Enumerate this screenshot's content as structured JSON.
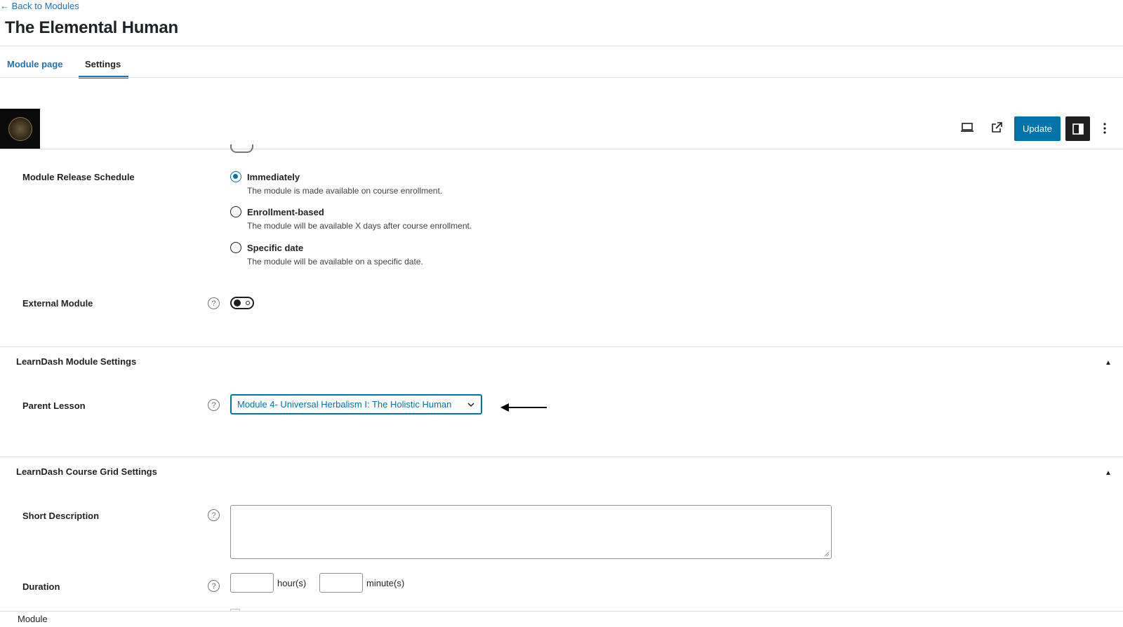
{
  "header": {
    "back_link": "← Back to Modules",
    "title": "The Elemental Human"
  },
  "tabs": [
    {
      "label": "Module page",
      "active": false
    },
    {
      "label": "Settings",
      "active": true
    }
  ],
  "toolbar": {
    "update_label": "Update",
    "icons": [
      "laptop-preview-icon",
      "external-link-icon",
      "sidebar-toggle-icon",
      "more-options-icon"
    ]
  },
  "release_schedule": {
    "label": "Module Release Schedule",
    "options": [
      {
        "label": "Immediately",
        "description": "The module is made available on course enrollment.",
        "selected": true
      },
      {
        "label": "Enrollment-based",
        "description": "The module will be available X days after course enrollment.",
        "selected": false
      },
      {
        "label": "Specific date",
        "description": "The module will be available on a specific date.",
        "selected": false
      }
    ]
  },
  "external_module": {
    "label": "External Module",
    "help": "?",
    "enabled": false
  },
  "module_settings": {
    "title": "LearnDash Module Settings",
    "parent_lesson": {
      "label": "Parent Lesson",
      "help": "?",
      "value": "Module 4- Universal Herbalism I: The Holistic Human"
    }
  },
  "grid_settings": {
    "title": "LearnDash Course Grid Settings",
    "short_description": {
      "label": "Short Description",
      "help": "?",
      "value": ""
    },
    "duration": {
      "label": "Duration",
      "help": "?",
      "hours_unit": "hour(s)",
      "minutes_unit": "minute(s)",
      "hours": "",
      "minutes": ""
    }
  },
  "footer": {
    "breadcrumb": "Module"
  },
  "colors": {
    "accent": "#0073aa",
    "dark": "#1e1e1e",
    "divider": "#dcdcde"
  }
}
